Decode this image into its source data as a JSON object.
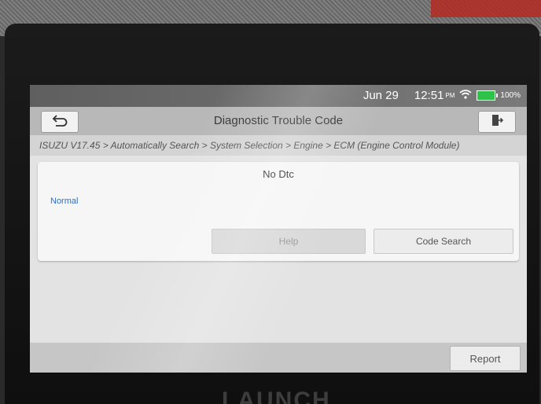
{
  "status": {
    "date": "Jun 29",
    "time": "12:51",
    "ampm": "PM",
    "battery": "100%"
  },
  "header": {
    "title": "Diagnostic Trouble Code"
  },
  "breadcrumb": "ISUZU V17.45 > Automatically Search > System Selection > Engine > ECM (Engine Control Module)",
  "result": {
    "message": "No Dtc",
    "status": "Normal",
    "status_color": "#2a6fc9"
  },
  "buttons": {
    "help": "Help",
    "code_search": "Code Search",
    "report": "Report"
  },
  "device": {
    "brand": "LAUNCH"
  },
  "icons": {
    "back": "back-arrow-icon",
    "exit": "exit-door-icon",
    "wifi": "wifi-icon",
    "battery": "battery-icon"
  }
}
